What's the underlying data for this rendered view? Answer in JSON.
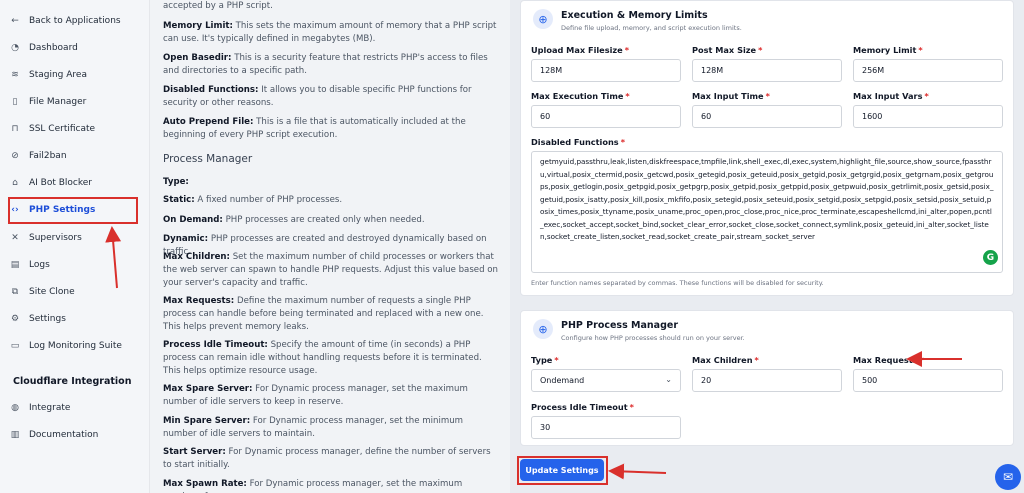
{
  "sidebar": {
    "items": [
      {
        "label": "Back to Applications",
        "icon": "arrow-left-icon"
      },
      {
        "label": "Dashboard",
        "icon": "gauge-icon"
      },
      {
        "label": "Staging Area",
        "icon": "layers-icon"
      },
      {
        "label": "File Manager",
        "icon": "file-icon"
      },
      {
        "label": "SSL Certificate",
        "icon": "lock-icon"
      },
      {
        "label": "Fail2ban",
        "icon": "ban-icon"
      },
      {
        "label": "AI Bot Blocker",
        "icon": "robot-icon"
      },
      {
        "label": "PHP Settings",
        "icon": "code-icon"
      },
      {
        "label": "Supervisors",
        "icon": "tools-icon"
      },
      {
        "label": "Logs",
        "icon": "doc-icon"
      },
      {
        "label": "Site Clone",
        "icon": "copy-icon"
      },
      {
        "label": "Settings",
        "icon": "gear-icon"
      },
      {
        "label": "Log Monitoring Suite",
        "icon": "monitor-icon"
      }
    ],
    "section_title": "Cloudflare Integration",
    "section_items": [
      {
        "label": "Integrate",
        "icon": "globe-icon"
      },
      {
        "label": "Documentation",
        "icon": "book-icon"
      }
    ]
  },
  "doc": {
    "intro_tail": "accepted by a PHP script.",
    "memory_limit": {
      "term": "Memory Limit:",
      "text": " This sets the maximum amount of memory that a PHP script can use. It's typically defined in megabytes (MB)."
    },
    "open_basedir": {
      "term": "Open Basedir:",
      "text": " This is a security feature that restricts PHP's access to files and directories to a specific path."
    },
    "disabled_functions": {
      "term": "Disabled Functions:",
      "text": " It allows you to disable specific PHP functions for security or other reasons."
    },
    "auto_prepend": {
      "term": "Auto Prepend File:",
      "text": " This is a file that is automatically included at the beginning of every PHP script execution."
    },
    "pm_heading": "Process Manager",
    "type": {
      "term": "Type:",
      "text": ""
    },
    "static": {
      "term": "Static:",
      "text": " A fixed number of PHP processes."
    },
    "on_demand": {
      "term": "On Demand:",
      "text": " PHP processes are created only when needed."
    },
    "dynamic": {
      "term": "Dynamic:",
      "text": " PHP processes are created and destroyed dynamically based on traffic."
    },
    "max_children": {
      "term": "Max Children:",
      "text": " Set the maximum number of child processes or workers that the web server can spawn to handle PHP requests. Adjust this value based on your server's capacity and traffic."
    },
    "max_requests": {
      "term": "Max Requests:",
      "text": " Define the maximum number of requests a single PHP process can handle before being terminated and replaced with a new one. This helps prevent memory leaks."
    },
    "idle_timeout": {
      "term": "Process Idle Timeout:",
      "text": " Specify the amount of time (in seconds) a PHP process can remain idle without handling requests before it is terminated. This helps optimize resource usage."
    },
    "max_spare": {
      "term": "Max Spare Server:",
      "text": " For Dynamic process manager, set the maximum number of idle servers to keep in reserve."
    },
    "min_spare": {
      "term": "Min Spare Server:",
      "text": " For Dynamic process manager, set the minimum number of idle servers to maintain."
    },
    "start_server": {
      "term": "Start Server:",
      "text": " For Dynamic process manager, define the number of servers to start initially."
    },
    "max_spawn": {
      "term": "Max Spawn Rate:",
      "text": " For Dynamic process manager, set the maximum number of"
    }
  },
  "exec_card": {
    "title": "Execution & Memory Limits",
    "subtitle": "Define file upload, memory, and script execution limits.",
    "fields": {
      "upload_max": {
        "label": "Upload Max Filesize",
        "value": "128M"
      },
      "post_max": {
        "label": "Post Max Size",
        "value": "128M"
      },
      "memory_limit": {
        "label": "Memory Limit",
        "value": "256M"
      },
      "max_exec": {
        "label": "Max Execution Time",
        "value": "60"
      },
      "max_input_time": {
        "label": "Max Input Time",
        "value": "60"
      },
      "max_input_vars": {
        "label": "Max Input Vars",
        "value": "1600"
      }
    },
    "disabled_label": "Disabled Functions",
    "disabled_value": "getmyuid,passthru,leak,listen,diskfreespace,tmpfile,link,shell_exec,dl,exec,system,highlight_file,source,show_source,fpassthru,virtual,posix_ctermid,posix_getcwd,posix_getegid,posix_geteuid,posix_getgid,posix_getgrgid,posix_getgrnam,posix_getgroups,posix_getlogin,posix_getpgid,posix_getpgrp,posix_getpid,posix_getppid,posix_getpwuid,posix_getrlimit,posix_getsid,posix_getuid,posix_isatty,posix_kill,posix_mkfifo,posix_setegid,posix_seteuid,posix_setgid,posix_setpgid,posix_setsid,posix_setuid,posix_times,posix_ttyname,posix_uname,proc_open,proc_close,proc_nice,proc_terminate,escapeshellcmd,ini_alter,popen,pcntl_exec,socket_accept,socket_bind,socket_clear_error,socket_close,socket_connect,symlink,posix_geteuid,ini_alter,socket_listen,socket_create_listen,socket_read,socket_create_pair,stream_socket_server",
    "disabled_hint": "Enter function names separated by commas. These functions will be disabled for security.",
    "grammarly_glyph": "G"
  },
  "pm_card": {
    "title": "PHP Process Manager",
    "subtitle": "Configure how PHP processes should run on your server.",
    "type": {
      "label": "Type",
      "value": "Ondemand"
    },
    "max_children": {
      "label": "Max Children",
      "value": "20"
    },
    "max_requests": {
      "label": "Max Requests",
      "value": "500"
    },
    "idle_timeout": {
      "label": "Process Idle Timeout",
      "value": "30"
    }
  },
  "actions": {
    "update_label": "Update Settings"
  },
  "colors": {
    "accent": "#2563eb",
    "annotation": "#d9302c",
    "required": "#dc2626"
  }
}
